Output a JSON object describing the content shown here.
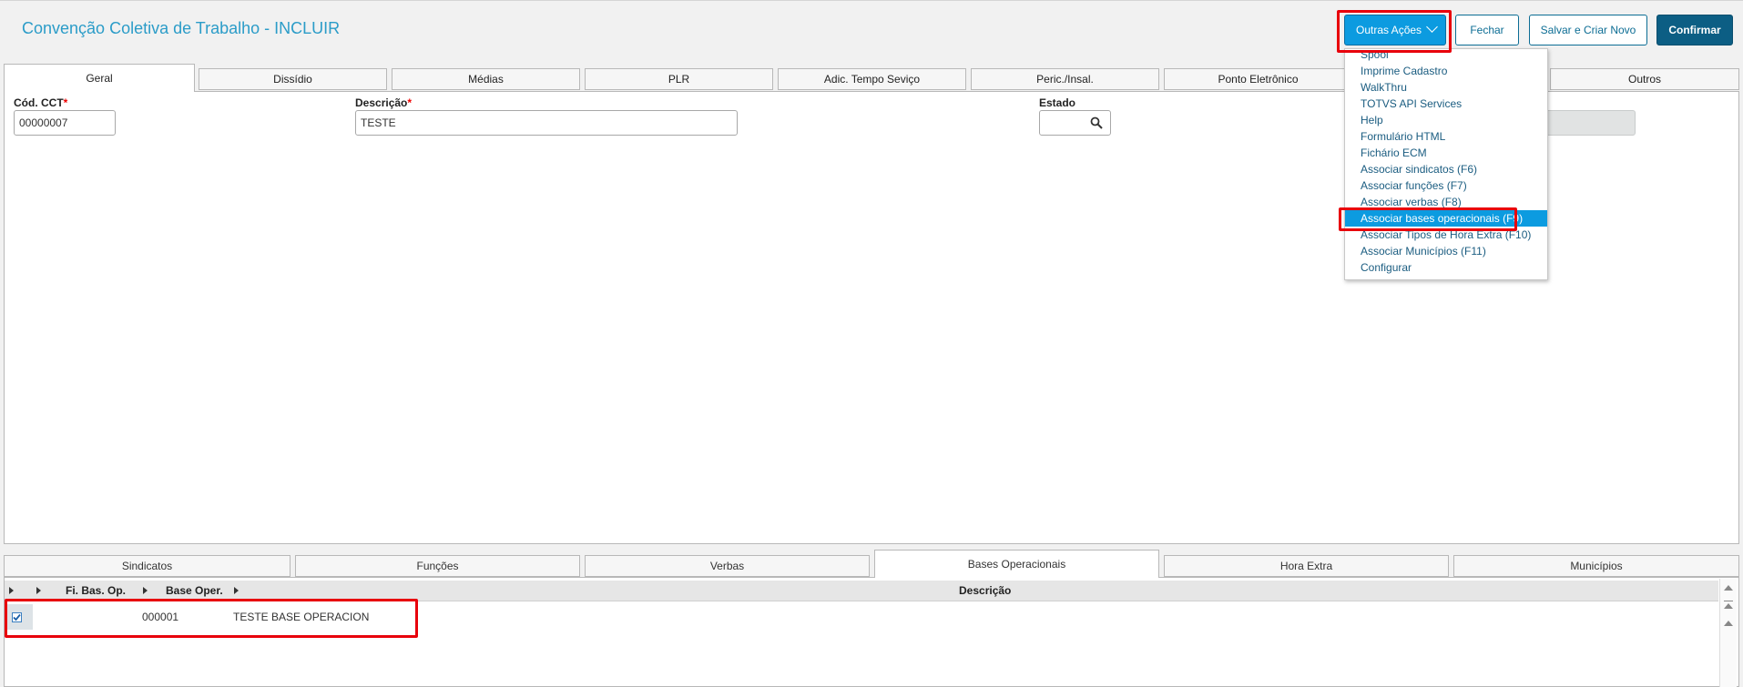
{
  "header": {
    "title": "Convenção Coletiva de Trabalho - INCLUIR",
    "buttons": {
      "outras_acoes": "Outras Ações",
      "fechar": "Fechar",
      "salvar_criar": "Salvar e Criar Novo",
      "confirmar": "Confirmar"
    }
  },
  "tabs": [
    "Geral",
    "Dissídio",
    "Médias",
    "PLR",
    "Adic. Tempo Seviço",
    "Peric./Insal.",
    "Ponto Eletrônico",
    "Outros"
  ],
  "form": {
    "cod_label": "Cód. CCT",
    "cod_value": "00000007",
    "desc_label": "Descrição",
    "desc_value": "TESTE",
    "estado_label": "Estado",
    "required_mark": "*"
  },
  "menu": {
    "items": [
      "Spool",
      "Imprime Cadastro",
      "WalkThru",
      "TOTVS API Services",
      "Help",
      "Formulário HTML",
      "Fichário ECM",
      "Associar sindicatos (F6)",
      "Associar funções (F7)",
      "Associar verbas (F8)",
      "Associar bases operacionais (F9)",
      "Associar Tipos de Hora Extra (F10)",
      "Associar Municípios (F11)",
      "Configurar"
    ],
    "selected_index": 10
  },
  "bottom_tabs": [
    "Sindicatos",
    "Funções",
    "Verbas",
    "Bases Operacionais",
    "Hora Extra",
    "Municípios"
  ],
  "grid": {
    "headers": [
      "Fi. Bas. Op.",
      "Base Oper.",
      "Descrição"
    ],
    "rows": [
      {
        "fi_bas_op": "",
        "base_oper": "000001",
        "descricao": "TESTE BASE OPERACION"
      }
    ]
  },
  "colors": {
    "accent": "#0c9be0",
    "title": "#2b9cc8",
    "primary_dark": "#0c5e84",
    "highlight": "#e8000b"
  }
}
